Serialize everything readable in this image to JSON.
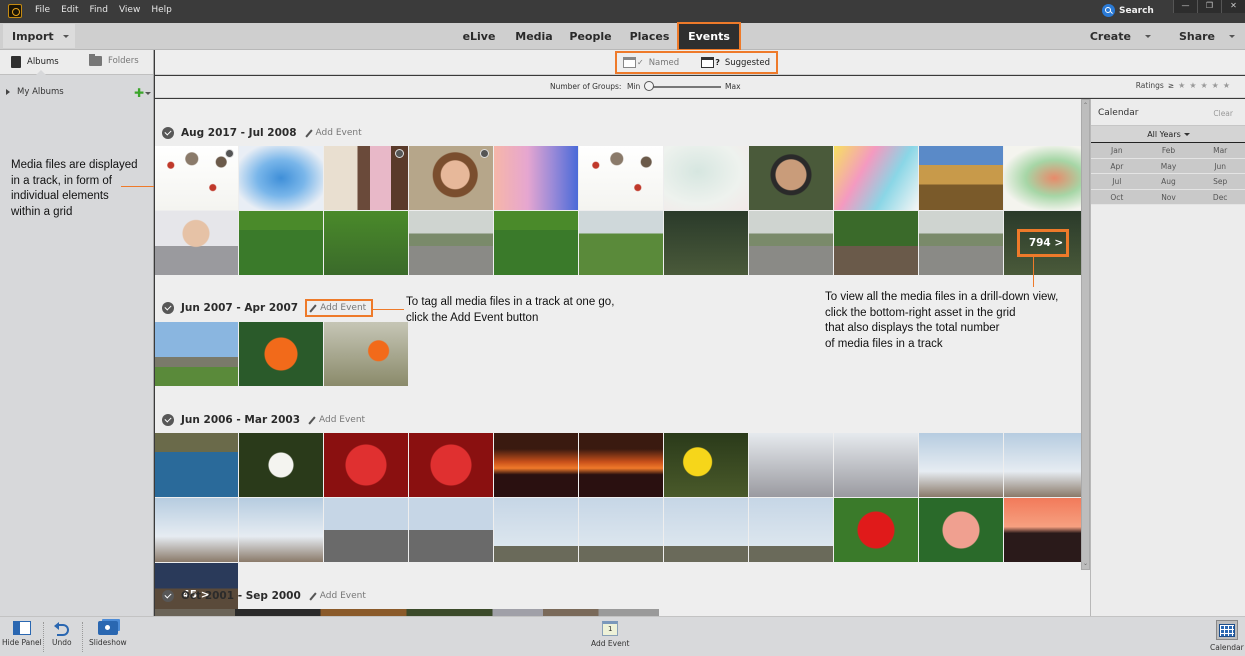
{
  "app": {
    "menu": [
      "File",
      "Edit",
      "Find",
      "View",
      "Help"
    ],
    "search_label": "Search",
    "window_controls": [
      "minimize",
      "restore",
      "close"
    ]
  },
  "toolbar": {
    "import_label": "Import",
    "tabs": [
      {
        "label": "eLive",
        "active": false
      },
      {
        "label": "Media",
        "active": false
      },
      {
        "label": "People",
        "active": false
      },
      {
        "label": "Places",
        "active": false
      },
      {
        "label": "Events",
        "active": true
      }
    ],
    "create_label": "Create",
    "share_label": "Share"
  },
  "left_panel": {
    "tabs": [
      {
        "label": "Albums",
        "icon": "album-book-icon",
        "active": true
      },
      {
        "label": "Folders",
        "icon": "folder-icon",
        "active": false
      }
    ],
    "my_albums_label": "My Albums",
    "annotation": "Media files are displayed in a track, in form of individual elements within a grid"
  },
  "events_view": {
    "modes": [
      {
        "label": "Named",
        "selected": false
      },
      {
        "label": "Suggested",
        "selected": true
      }
    ],
    "groups_label": "Number of Groups:",
    "groups_min": "Min",
    "groups_max": "Max",
    "groups_level": 0,
    "ratings_label": "Ratings",
    "ratings_op": "≥",
    "ratings_stars": 5
  },
  "groups": [
    {
      "title": "Aug 2017 - Jul 2008",
      "add_event": "Add Event",
      "more_count": "794 >",
      "thumbs": [
        {
          "kind": "flowers-pattern",
          "video": true
        },
        {
          "kind": "blue-watercolor",
          "video": false
        },
        {
          "kind": "child-reaching",
          "video": true
        },
        {
          "kind": "girl-portrait",
          "video": true
        },
        {
          "kind": "pink-watercolor",
          "video": false
        },
        {
          "kind": "flowers-pattern",
          "video": false
        },
        {
          "kind": "pale-watercolor",
          "video": false
        },
        {
          "kind": "man-portrait",
          "video": false
        },
        {
          "kind": "rainbow-splash",
          "video": false
        },
        {
          "kind": "mountain-biker",
          "video": false
        },
        {
          "kind": "green-splash",
          "video": false
        },
        {
          "kind": "man-in-suit",
          "video": false
        },
        {
          "kind": "family-grass",
          "video": false
        },
        {
          "kind": "family-lying",
          "video": false
        },
        {
          "kind": "road-family",
          "video": false
        },
        {
          "kind": "family-grass",
          "video": false
        },
        {
          "kind": "father-son",
          "video": false
        },
        {
          "kind": "family-dark",
          "video": false
        },
        {
          "kind": "road-family",
          "video": false
        },
        {
          "kind": "family-bench",
          "video": false
        },
        {
          "kind": "road-family",
          "video": false
        },
        {
          "kind": "family-dark",
          "video": false
        }
      ]
    },
    {
      "title": "Jun 2007 - Apr 2007",
      "add_event": "Add Event",
      "thumbs": [
        {
          "kind": "girl-jumping",
          "video": false
        },
        {
          "kind": "orange-poppy",
          "video": false
        },
        {
          "kind": "orange-poppy-2",
          "video": false
        }
      ]
    },
    {
      "title": "Jun 2006 - Mar 2003",
      "add_event": "Add Event",
      "more_count": "45 >",
      "thumbs": [
        {
          "kind": "water-ski",
          "video": false
        },
        {
          "kind": "white-flower",
          "video": false
        },
        {
          "kind": "red-dahlia",
          "video": false
        },
        {
          "kind": "red-dahlia",
          "video": false
        },
        {
          "kind": "sunset",
          "video": false
        },
        {
          "kind": "sunset",
          "video": false
        },
        {
          "kind": "yellow-daisy",
          "video": false
        },
        {
          "kind": "eiffel-base",
          "video": false
        },
        {
          "kind": "eiffel-base",
          "video": false
        },
        {
          "kind": "eiffel-sky",
          "video": false
        },
        {
          "kind": "eiffel-sky",
          "video": false
        },
        {
          "kind": "eiffel-sky",
          "video": false
        },
        {
          "kind": "eiffel-sky",
          "video": false
        },
        {
          "kind": "eiffel-arch",
          "video": false
        },
        {
          "kind": "eiffel-arch",
          "video": false
        },
        {
          "kind": "eiffel-far",
          "video": false
        },
        {
          "kind": "eiffel-far",
          "video": false
        },
        {
          "kind": "eiffel-far",
          "video": false
        },
        {
          "kind": "eiffel-far",
          "video": false
        },
        {
          "kind": "red-rose",
          "video": false
        },
        {
          "kind": "lily",
          "video": false
        },
        {
          "kind": "mountain-sunset",
          "video": false
        },
        {
          "kind": "city-night",
          "video": false
        }
      ]
    },
    {
      "title": "Oct 2001 - Sep 2000",
      "add_event": "Add Event",
      "thumbs": []
    }
  ],
  "annotations": {
    "add_event": "To tag all media files in a track at one go, click the Add Event button",
    "add_event_lines": [
      "To tag all media files in a track at one go,",
      "click the Add Event button"
    ],
    "drilldown_lines": [
      "To view all the media files in a drill-down view,",
      "click the bottom-right asset in the grid",
      "that also displays the total number",
      "of media files in a track"
    ],
    "left_lines": [
      "Media files are displayed",
      "in a track, in form of",
      "individual elements",
      "within a grid"
    ]
  },
  "calendar": {
    "title": "Calendar",
    "clear_label": "Clear",
    "years_label": "All Years",
    "months": [
      [
        "Jan",
        "Feb",
        "Mar"
      ],
      [
        "Apr",
        "May",
        "Jun"
      ],
      [
        "Jul",
        "Aug",
        "Sep"
      ],
      [
        "Oct",
        "Nov",
        "Dec"
      ]
    ]
  },
  "bottom_bar": {
    "hide_panel": "Hide Panel",
    "undo": "Undo",
    "slideshow": "Slideshow",
    "add_event": "Add Event",
    "add_event_icon_text": "1",
    "calendar": "Calendar"
  },
  "colors": {
    "accent_highlight": "#ee7a2a",
    "active_tab_bg": "#2f2f2f",
    "search_blue": "#2a7ad6",
    "add_green": "#3ba52b"
  }
}
